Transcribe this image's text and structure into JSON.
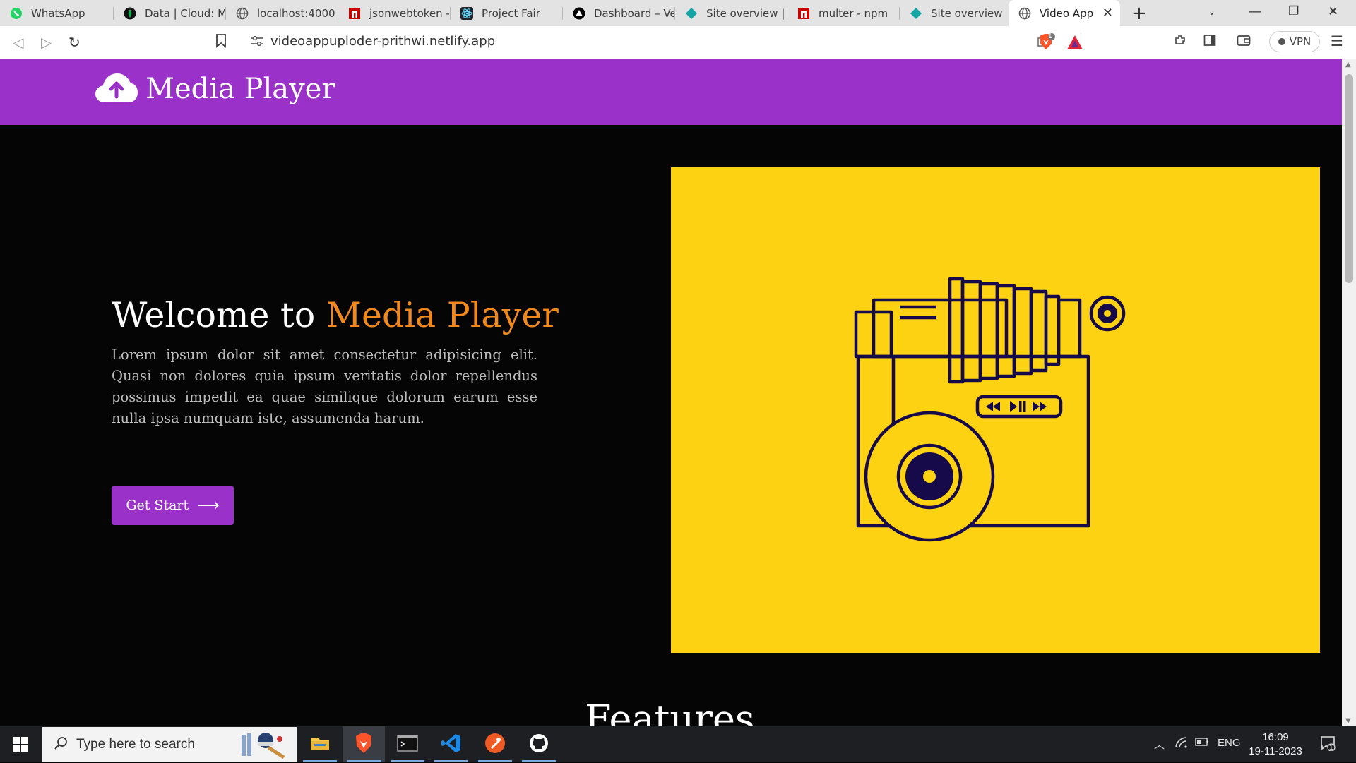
{
  "browser": {
    "tabs": [
      {
        "label": "WhatsApp",
        "icon": "whatsapp-icon"
      },
      {
        "label": "Data | Cloud: Mc",
        "icon": "mongodb-icon"
      },
      {
        "label": "localhost:4000",
        "icon": "globe-icon"
      },
      {
        "label": "jsonwebtoken - r",
        "icon": "npm-icon"
      },
      {
        "label": "Project Fair",
        "icon": "react-icon"
      },
      {
        "label": "Dashboard – Ver",
        "icon": "vercel-icon"
      },
      {
        "label": "Site overview | vi",
        "icon": "netlify-icon"
      },
      {
        "label": "multer - npm",
        "icon": "npm-icon"
      },
      {
        "label": "Site overview | vi",
        "icon": "netlify-icon"
      },
      {
        "label": "Video App",
        "icon": "globe-icon",
        "active": true
      }
    ],
    "url": "videoappuploder-prithwi.netlify.app",
    "vpn_label": "VPN",
    "shield_badge": "1"
  },
  "site": {
    "brand": "Media Player",
    "hero": {
      "title_prefix": "Welcome to ",
      "title_accent": "Media Player",
      "body": "Lorem ipsum dolor sit amet consectetur adipisicing elit. Quasi non dolores quia ipsum veritatis dolor repellendus possimus impedit ea quae similique dolorum earum esse nulla ipsa numquam iste, assumenda harum.",
      "cta_label": "Get Start",
      "cta_arrow": "⟶"
    },
    "features_heading": "Features"
  },
  "colors": {
    "header_purple": "#9a31c9",
    "accent_orange": "#f0891b",
    "hero_yellow": "#fdd212",
    "illustration_navy": "#170a4a"
  },
  "taskbar": {
    "search_placeholder": "Type here to search",
    "apps": [
      "file-explorer-icon",
      "brave-icon",
      "terminal-icon",
      "vscode-icon",
      "postman-icon",
      "github-icon"
    ],
    "tray": {
      "language": "ENG",
      "time": "16:09",
      "date": "19-11-2023",
      "notification_count": "1"
    }
  }
}
